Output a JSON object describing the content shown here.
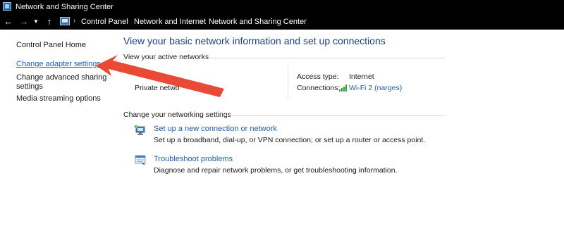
{
  "window": {
    "title": "Network and Sharing Center"
  },
  "address_bar": {
    "breadcrumbs": [
      "Control Panel",
      "Network and Internet",
      "Network and Sharing Center"
    ]
  },
  "left_pane": {
    "links": [
      {
        "label": "Control Panel Home"
      },
      {
        "label": "Change adapter settings"
      },
      {
        "label": "Change advanced sharing"
      },
      {
        "label": "settings"
      },
      {
        "label": "Media streaming options"
      }
    ]
  },
  "main": {
    "title": "View your basic network information and set up connections",
    "active_networks_label": "View your active networks",
    "network_name_partial": "Private netwo",
    "access_type_label": "Access type:",
    "access_type_value": "Internet",
    "connections_label": "Connections:",
    "connections_value": "Wi-Fi 2 (narges)",
    "change_settings_label": "Change your networking settings",
    "tasks": [
      {
        "link": "Set up a new connection or network",
        "description": "Set up a broadband, dial-up, or VPN connection; or set up a router or access point.",
        "icon": "network-setup-icon"
      },
      {
        "link": "Troubleshoot problems",
        "description": "Diagnose and repair network problems, or get troubleshooting information.",
        "icon": "troubleshoot-icon"
      }
    ]
  },
  "colors": {
    "title_bar": "#000000",
    "link": "#1a5fb4",
    "heading": "#1e3f8a",
    "annotation_arrow": "#e8402a"
  },
  "icons": {
    "back": "arrow-left-icon",
    "forward": "arrow-right-icon",
    "recent": "chevron-down-icon",
    "up": "arrow-up-icon",
    "wifi": "wifi-signal-icon"
  }
}
